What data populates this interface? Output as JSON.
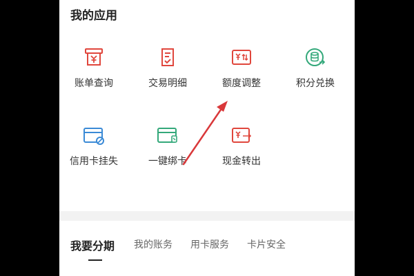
{
  "section_title": "我的应用",
  "apps": [
    {
      "label": "账单查询",
      "icon": "bill-query-icon"
    },
    {
      "label": "交易明细",
      "icon": "transaction-detail-icon"
    },
    {
      "label": "额度调整",
      "icon": "credit-limit-adjust-icon"
    },
    {
      "label": "积分兑换",
      "icon": "points-exchange-icon"
    },
    {
      "label": "信用卡挂失",
      "icon": "card-report-loss-icon"
    },
    {
      "label": "一键绑卡",
      "icon": "bind-card-icon"
    },
    {
      "label": "现金转出",
      "icon": "cash-transfer-icon"
    }
  ],
  "tabs": [
    {
      "label": "我要分期",
      "active": true
    },
    {
      "label": "我的账务",
      "active": false
    },
    {
      "label": "用卡服务",
      "active": false
    },
    {
      "label": "卡片安全",
      "active": false
    }
  ],
  "colors": {
    "icon_red": "#e0463c",
    "icon_blue": "#3a8ad6",
    "icon_green": "#33a87a",
    "annotation_arrow": "#d9383a"
  }
}
